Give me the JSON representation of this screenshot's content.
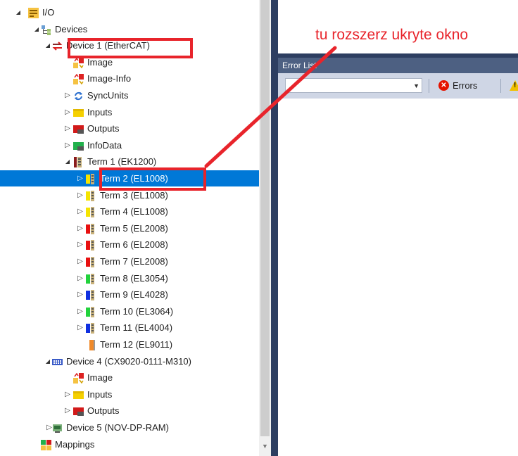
{
  "tree": {
    "rows": [
      {
        "label": "I/O",
        "icon": "io-icon",
        "expander": "expanded"
      },
      {
        "label": "Devices",
        "icon": "devices-icon",
        "expander": "expanded"
      },
      {
        "label": "Device 1 (EtherCAT)",
        "icon": "ethercat-device-icon",
        "expander": "expanded"
      },
      {
        "label": "Image",
        "icon": "image-icon",
        "expander": "none"
      },
      {
        "label": "Image-Info",
        "icon": "image-info-icon",
        "expander": "none"
      },
      {
        "label": "SyncUnits",
        "icon": "syncunits-icon",
        "expander": "collapsed"
      },
      {
        "label": "Inputs",
        "icon": "inputs-icon",
        "expander": "collapsed"
      },
      {
        "label": "Outputs",
        "icon": "outputs-icon",
        "expander": "collapsed"
      },
      {
        "label": "InfoData",
        "icon": "infodata-icon",
        "expander": "collapsed"
      },
      {
        "label": "Term 1 (EK1200)",
        "icon": "coupler-icon",
        "expander": "expanded"
      },
      {
        "label": "Term 2 (EL1008)",
        "icon": "terminal-yellow-icon",
        "expander": "collapsed",
        "selected": true
      },
      {
        "label": "Term 3 (EL1008)",
        "icon": "terminal-yellow-icon",
        "expander": "collapsed"
      },
      {
        "label": "Term 4 (EL1008)",
        "icon": "terminal-yellow-icon",
        "expander": "collapsed"
      },
      {
        "label": "Term 5 (EL2008)",
        "icon": "terminal-red-icon",
        "expander": "collapsed"
      },
      {
        "label": "Term 6 (EL2008)",
        "icon": "terminal-red-icon",
        "expander": "collapsed"
      },
      {
        "label": "Term 7 (EL2008)",
        "icon": "terminal-red-icon",
        "expander": "collapsed"
      },
      {
        "label": "Term 8 (EL3054)",
        "icon": "terminal-green-icon",
        "expander": "collapsed"
      },
      {
        "label": "Term 9 (EL4028)",
        "icon": "terminal-blue-icon",
        "expander": "collapsed"
      },
      {
        "label": "Term 10 (EL3064)",
        "icon": "terminal-green-icon",
        "expander": "collapsed"
      },
      {
        "label": "Term 11 (EL4004)",
        "icon": "terminal-blue-icon",
        "expander": "collapsed"
      },
      {
        "label": "Term 12 (EL9011)",
        "icon": "end-terminal-icon",
        "expander": "none"
      },
      {
        "label": "Device 4 (CX9020-0111-M310)",
        "icon": "cx-device-icon",
        "expander": "expanded"
      },
      {
        "label": "Image",
        "icon": "image-icon",
        "expander": "none"
      },
      {
        "label": "Inputs",
        "icon": "inputs-icon",
        "expander": "collapsed"
      },
      {
        "label": "Outputs",
        "icon": "outputs-icon",
        "expander": "collapsed"
      },
      {
        "label": "Device 5 (NOV-DP-RAM)",
        "icon": "profibus-device-icon",
        "expander": "collapsed"
      },
      {
        "label": "Mappings",
        "icon": "mappings-icon",
        "expander": "none"
      }
    ]
  },
  "error_list": {
    "title": "Error List",
    "filter_value": "",
    "errors_label": "Errors"
  },
  "annotation": {
    "text": "tu rozszerz ukryte okno"
  },
  "colors": {
    "selection": "#0078d7",
    "annotation": "#e8242b",
    "dock_dark": "#2d3e61",
    "error_title_bar": "#4d6082",
    "toolbar": "#cfd6e5"
  }
}
